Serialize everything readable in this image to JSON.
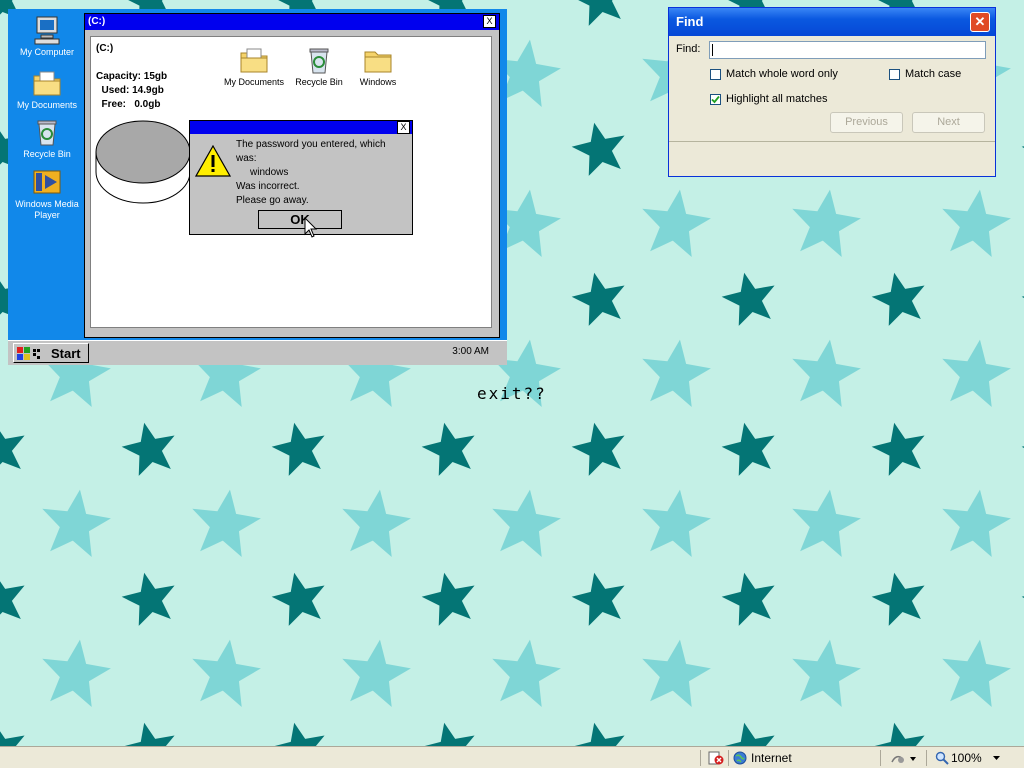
{
  "colors": {
    "background": "#c4f0e6",
    "star_dark": "#047575",
    "star_light": "#7fd6d6",
    "fake_desktop": "#1188ea",
    "title_blue": "#0000ee"
  },
  "desktop_icons": [
    {
      "label": "My Computer",
      "icon": "computer-icon"
    },
    {
      "label": "My Documents",
      "icon": "folder-documents-icon"
    },
    {
      "label": "Recycle Bin",
      "icon": "recycle-bin-icon"
    },
    {
      "label": "Windows Media Player",
      "icon": "media-player-icon"
    }
  ],
  "drive_window": {
    "title": "(C:)",
    "close_label": "X",
    "drive_label": "(C:)",
    "stats": {
      "capacity": "Capacity: 15gb",
      "used": "  Used: 14.9gb",
      "free": "  Free:   0.0gb"
    },
    "folders": [
      {
        "label": "My Documents",
        "icon": "folder-documents-icon"
      },
      {
        "label": "Recycle Bin",
        "icon": "recycle-bin-icon"
      },
      {
        "label": "Windows",
        "icon": "folder-icon"
      }
    ]
  },
  "taskbar": {
    "start_label": "Start",
    "clock": "3:00 AM"
  },
  "alert": {
    "close_label": "X",
    "line1": "The password you entered, which",
    "line2": "was:",
    "password": "windows",
    "line3": "Was incorrect.",
    "line4": "Please go away.",
    "ok_label": "OK"
  },
  "exit_text": "exit??",
  "find_dialog": {
    "title": "Find",
    "close_label": "✕",
    "find_label": "Find:",
    "find_value": "",
    "match_whole_word": {
      "label": "Match whole word only",
      "checked": false
    },
    "match_case": {
      "label": "Match case",
      "checked": false
    },
    "highlight_all": {
      "label": "Highlight all matches",
      "checked": true
    },
    "previous_label": "Previous",
    "next_label": "Next"
  },
  "statusbar": {
    "zone": "Internet",
    "zoom": "100%"
  }
}
